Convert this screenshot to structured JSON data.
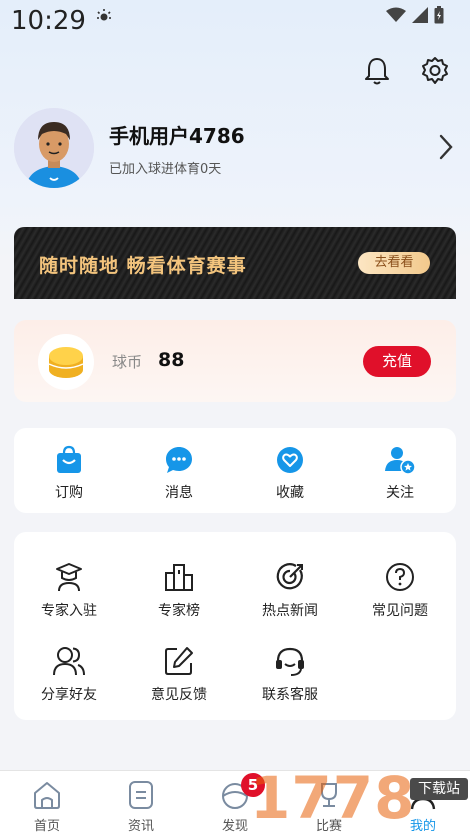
{
  "status": {
    "time": "10:29"
  },
  "profile": {
    "username": "手机用户4786",
    "joined": "已加入球进体育0天"
  },
  "banner": {
    "text": "随时随地 畅看体育赛事",
    "button": "去看看"
  },
  "coins": {
    "label": "球币",
    "value": "88",
    "recharge": "充值"
  },
  "quick": [
    {
      "label": "订购",
      "icon": "bag-icon"
    },
    {
      "label": "消息",
      "icon": "chat-icon"
    },
    {
      "label": "收藏",
      "icon": "heart-icon"
    },
    {
      "label": "关注",
      "icon": "user-star-icon"
    }
  ],
  "tools": [
    {
      "label": "专家入驻",
      "icon": "graduation-cap-icon"
    },
    {
      "label": "专家榜",
      "icon": "buildings-icon"
    },
    {
      "label": "热点新闻",
      "icon": "target-icon"
    },
    {
      "label": "常见问题",
      "icon": "question-icon"
    },
    {
      "label": "分享好友",
      "icon": "users-icon"
    },
    {
      "label": "意见反馈",
      "icon": "edit-icon"
    },
    {
      "label": "联系客服",
      "icon": "headset-icon"
    }
  ],
  "tabs": [
    {
      "label": "首页",
      "icon": "home-icon"
    },
    {
      "label": "资讯",
      "icon": "document-icon"
    },
    {
      "label": "发现",
      "icon": "discover-icon",
      "badge": "5"
    },
    {
      "label": "比赛",
      "icon": "trophy-icon"
    },
    {
      "label": "我的",
      "icon": "profile-icon"
    }
  ],
  "watermark": {
    "text": "1778",
    "badge": "下载站"
  },
  "colors": {
    "accent_blue": "#1696e8",
    "red": "#e0102a",
    "gold": "#f3c47d"
  }
}
